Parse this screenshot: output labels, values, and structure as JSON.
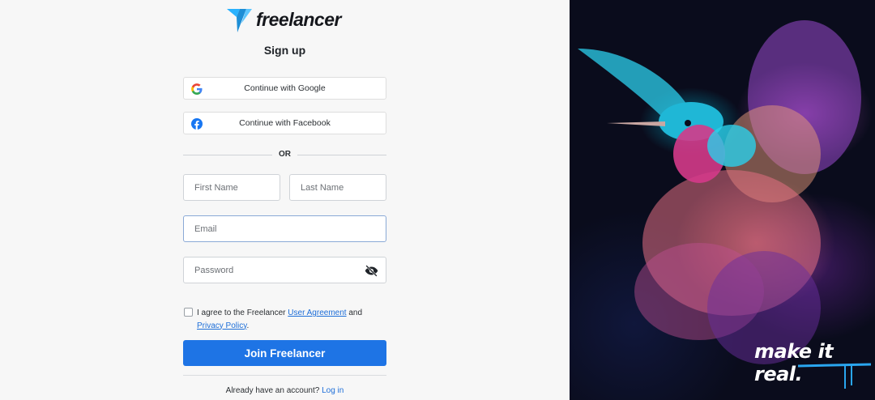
{
  "brand": {
    "name": "freelancer",
    "logo_icon": "freelancer-bird-logo",
    "accent": "#29b2fe"
  },
  "form": {
    "title": "Sign up",
    "google_label": "Continue with Google",
    "facebook_label": "Continue with Facebook",
    "or_label": "OR",
    "first_name_placeholder": "First Name",
    "last_name_placeholder": "Last Name",
    "email_placeholder": "Email",
    "password_placeholder": "Password",
    "agree_prefix": "I agree to the Freelancer ",
    "user_agreement": "User Agreement",
    "and": " and",
    "privacy_policy": "Privacy Policy",
    "period": ".",
    "join_label": "Join Freelancer",
    "have_account": "Already have an account? ",
    "login_label": "Log in"
  },
  "hero": {
    "slogan": "make it real.",
    "image": "colorful-hummingbird"
  },
  "colors": {
    "primary": "#1e74e5",
    "link": "#1d6ed8",
    "background": "#f7f7f7"
  }
}
